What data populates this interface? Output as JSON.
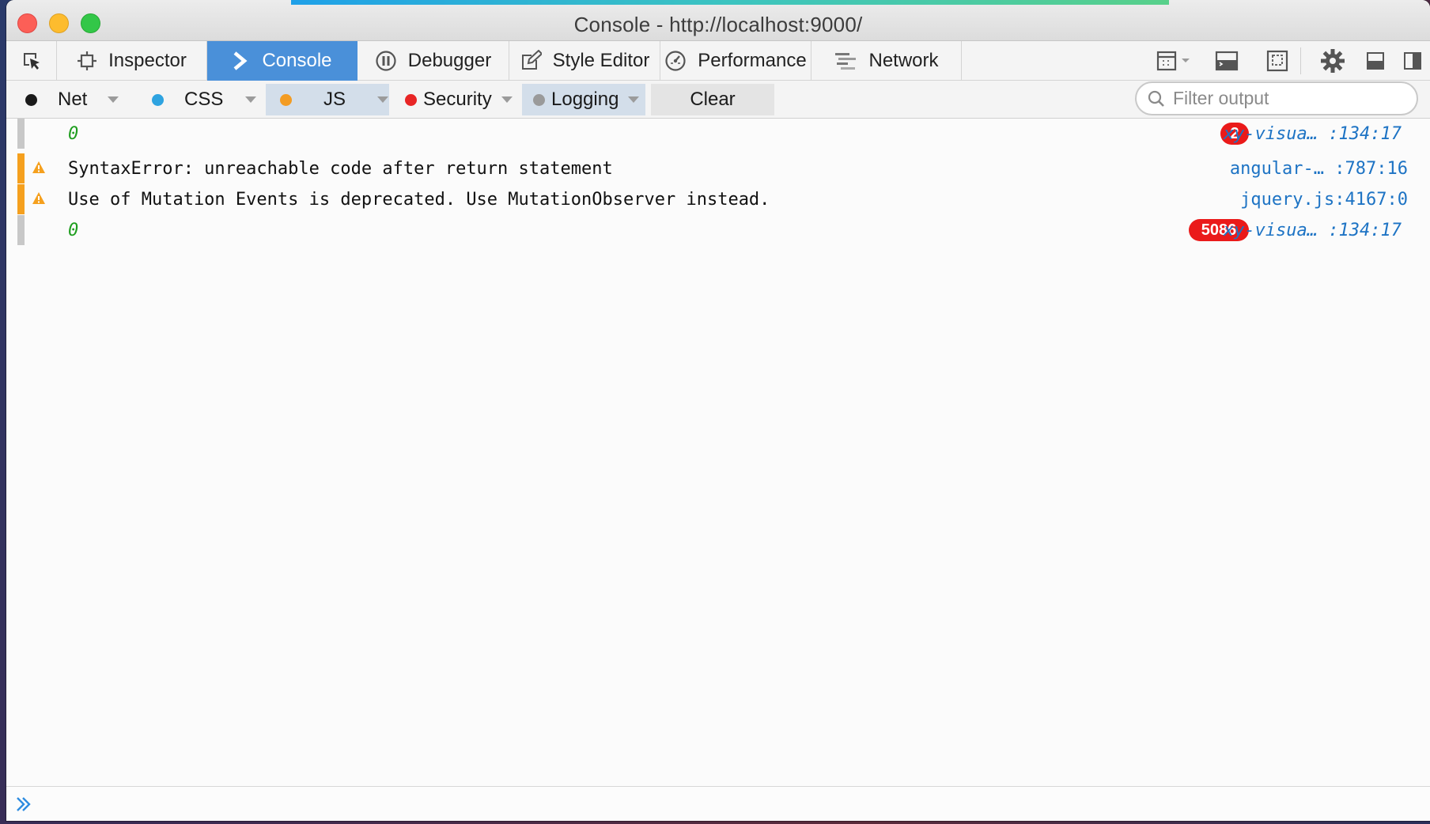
{
  "window": {
    "title": "Console - http://localhost:9000/"
  },
  "tabs": [
    {
      "label": "Inspector",
      "icon": "inspector-icon"
    },
    {
      "label": "Console",
      "icon": "console-icon",
      "active": true
    },
    {
      "label": "Debugger",
      "icon": "debugger-icon"
    },
    {
      "label": "Style Editor",
      "icon": "style-editor-icon"
    },
    {
      "label": "Performance",
      "icon": "performance-icon"
    },
    {
      "label": "Network",
      "icon": "network-icon"
    }
  ],
  "toolbar_icons": [
    "frame-select-icon",
    "split-console-icon",
    "responsive-mode-icon",
    "gear-icon",
    "dock-bottom-icon",
    "dock-side-icon"
  ],
  "filters": [
    {
      "label": "Net",
      "color": "#1a1a1a",
      "active": false
    },
    {
      "label": "CSS",
      "color": "#2ea3e0",
      "active": false
    },
    {
      "label": "JS",
      "color": "#f39c23",
      "active": true
    },
    {
      "label": "Security",
      "color": "#e82525",
      "active": false
    },
    {
      "label": "Logging",
      "color": "#9a9a9a",
      "active": true
    }
  ],
  "clear_label": "Clear",
  "filter_output": {
    "placeholder": "Filter output"
  },
  "messages": [
    {
      "type": "log",
      "text": "0",
      "badge": "2",
      "source": "xy-visua… :134:17"
    },
    {
      "type": "warn",
      "text": "SyntaxError: unreachable code after return statement",
      "source": "angular-… :787:16"
    },
    {
      "type": "warn",
      "text": "Use of Mutation Events is deprecated. Use MutationObserver instead.",
      "source": "jquery.js:4167:0"
    },
    {
      "type": "log",
      "text": "0",
      "badge": "5086",
      "source": "xy-visua… :134:17"
    }
  ],
  "colors": {
    "accent": "#4a90d9",
    "warning": "#f5a01e",
    "badge": "#ea1a1a",
    "link": "#1d73c4",
    "number": "#1f9e1f"
  }
}
